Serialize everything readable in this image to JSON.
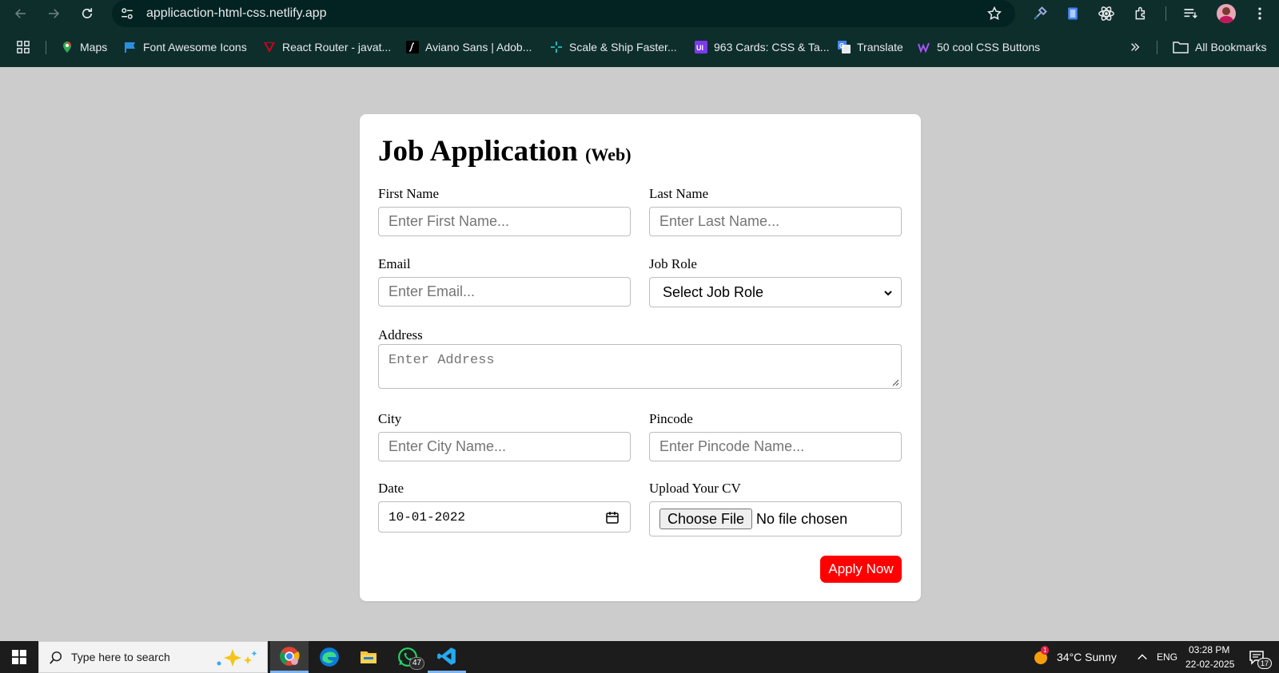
{
  "browser": {
    "url": "applicaction-html-css.netlify.app",
    "bookmarks": [
      {
        "label": "Maps",
        "icon": "maps-pin-icon"
      },
      {
        "label": "Font Awesome Icons",
        "icon": "flag-icon"
      },
      {
        "label": "React Router - javat...",
        "icon": "react-router-icon"
      },
      {
        "label": "Aviano Sans | Adob...",
        "icon": "adobe-fonts-icon"
      },
      {
        "label": "Scale & Ship Faster...",
        "icon": "sparkle-icon"
      },
      {
        "label": "963 Cards: CSS & Ta...",
        "icon": "uiverse-icon"
      },
      {
        "label": "Translate",
        "icon": "google-translate-icon"
      },
      {
        "label": "50 cool CSS Buttons",
        "icon": "webflow-icon"
      }
    ],
    "all_bookmarks": "All Bookmarks"
  },
  "form": {
    "title": "Job Application",
    "subtitle": "(Web)",
    "first_name_label": "First Name",
    "first_name_placeholder": "Enter First Name...",
    "last_name_label": "Last Name",
    "last_name_placeholder": "Enter Last Name...",
    "email_label": "Email",
    "email_placeholder": "Enter Email...",
    "job_role_label": "Job Role",
    "job_role_value": "Select Job Role",
    "address_label": "Address",
    "address_placeholder": "Enter Address",
    "city_label": "City",
    "city_placeholder": "Enter City Name...",
    "pincode_label": "Pincode",
    "pincode_placeholder": "Enter Pincode Name...",
    "date_label": "Date",
    "date_value": "10-01-2022",
    "cv_label": "Upload Your CV",
    "choose_file": "Choose File",
    "no_file": "No file chosen",
    "apply_label": "Apply Now",
    "accent_color": "#ff0000"
  },
  "taskbar": {
    "search_placeholder": "Type here to search",
    "whatsapp_badge": "47",
    "weather": "34°C  Sunny",
    "weather_badge": "1",
    "language": "ENG",
    "time": "03:28 PM",
    "date": "22-02-2025",
    "notification_count": "17"
  }
}
